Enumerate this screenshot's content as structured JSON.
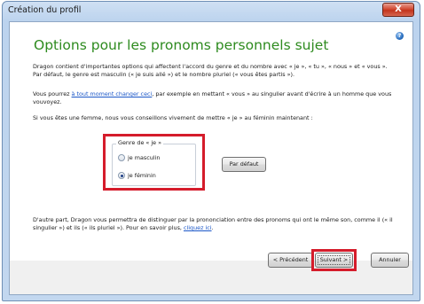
{
  "window": {
    "title": "Création du profil",
    "close_label": "X"
  },
  "page": {
    "heading": "Options pour les pronoms personnels sujet",
    "help_label": "?",
    "intro": "Dragon contient d'importantes options qui affectent l'accord du genre et du nombre avec « je », « tu », « nous » et « vous ». Par défaut, le genre est masculin (« je suis allé ») et le nombre pluriel (« vous êtes partis »).",
    "change_prefix": "Vous pourrez ",
    "change_link": "à tout moment changer ceci",
    "change_suffix": ", par exemple en mettant « vous » au singulier avant d'écrire à un homme que vous vouvoyez.",
    "female_advice": "Si vous êtes une femme, nous vous conseillons vivement de mettre « je » au féminin maintenant :",
    "gender_group": {
      "label": "Genre de « je »",
      "options": [
        "je masculin",
        "je féminin"
      ],
      "selected": "je féminin"
    },
    "default_button": "Par défaut",
    "footer_prefix": "D'autre part, Dragon vous permettra de distinguer par la prononciation entre des pronoms qui ont le même son, comme il (« il singulier ») et ils (« ils pluriel »).  Pour en savoir plus, ",
    "footer_link": "cliquez ici",
    "footer_suffix": "."
  },
  "buttons": {
    "previous": "< Précédent",
    "next": "Suivant >",
    "cancel": "Annuler"
  },
  "colors": {
    "heading": "#2e8b1f",
    "link": "#1b57c8",
    "highlight": "#d51c2b"
  }
}
